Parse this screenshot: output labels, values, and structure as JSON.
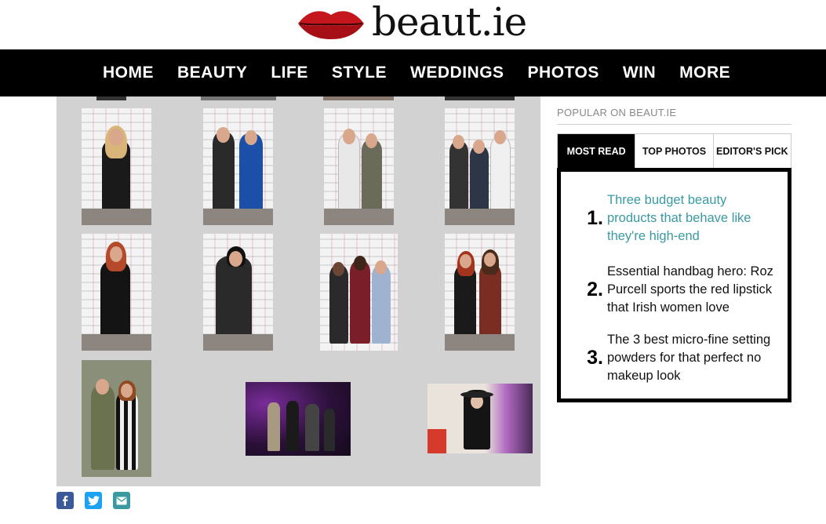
{
  "header": {
    "logo_text": "beaut.ie"
  },
  "nav": {
    "items": [
      "HOME",
      "BEAUTY",
      "LIFE",
      "STYLE",
      "WEDDINGS",
      "PHOTOS",
      "WIN",
      "MORE"
    ]
  },
  "share": {
    "icons": [
      "facebook-icon",
      "twitter-icon",
      "email-icon"
    ]
  },
  "sidebar": {
    "title": "POPULAR ON BEAUT.IE",
    "tabs": [
      {
        "label": "MOST READ",
        "active": true
      },
      {
        "label": "TOP PHOTOS",
        "active": false
      },
      {
        "label": "EDITOR'S PICK",
        "active": false
      }
    ],
    "articles": [
      {
        "num": "1.",
        "title": "Three budget beauty products that behave like they're high-end"
      },
      {
        "num": "2.",
        "title": "Essential handbag hero: Roz Purcell sports the red lipstick that Irish women love"
      },
      {
        "num": "3.",
        "title": "The 3 best micro-fine setting powders for that perfect no makeup look"
      }
    ]
  },
  "colors": {
    "nav_bg": "#000000",
    "gallery_bg": "#d2d2d2",
    "link_teal": "#3a9aa2",
    "facebook": "#3b5998",
    "twitter": "#1da1f2",
    "email": "#3a9aa2"
  }
}
